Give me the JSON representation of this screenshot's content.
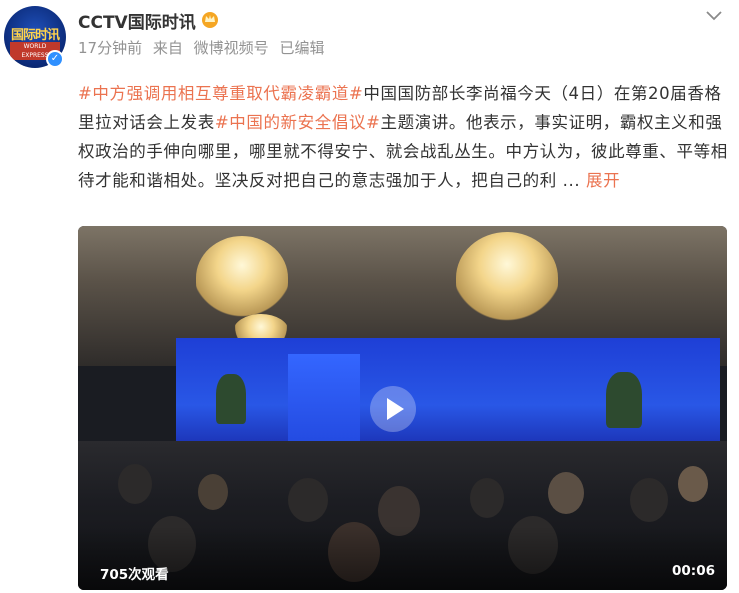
{
  "header": {
    "username": "CCTV国际时讯",
    "time": "17分钟前",
    "source_prefix": "来自",
    "source": "微博视频号",
    "edited": "已编辑",
    "avatar_text": "国际时讯",
    "avatar_subtext": "WORLD EXPRESS"
  },
  "post": {
    "hashtag1": "#中方强调用相互尊重取代霸凌霸道#",
    "text1": "中国国防部长李尚福今天（4日）在第20届香格里拉对话会上发表",
    "hashtag2": "#中国的新安全倡议#",
    "text2": "主题演讲。他表示，事实证明，霸权主义和强权政治的手伸向哪里，哪里就不得安宁、就会战乱丛生。中方认为，彼此尊重、平等相待才能和谐相处。坚决反对把自己的意志强加于人，把自己的利 ... ",
    "expand_label": "展开"
  },
  "video": {
    "views": "705次观看",
    "duration": "00:06"
  },
  "colors": {
    "hashtag": "#eb7350",
    "meta_gray": "#939393",
    "verified_blue": "#2f90ff"
  },
  "icons": [
    "crown-icon",
    "chevron-down-icon",
    "verified-icon",
    "play-icon"
  ]
}
